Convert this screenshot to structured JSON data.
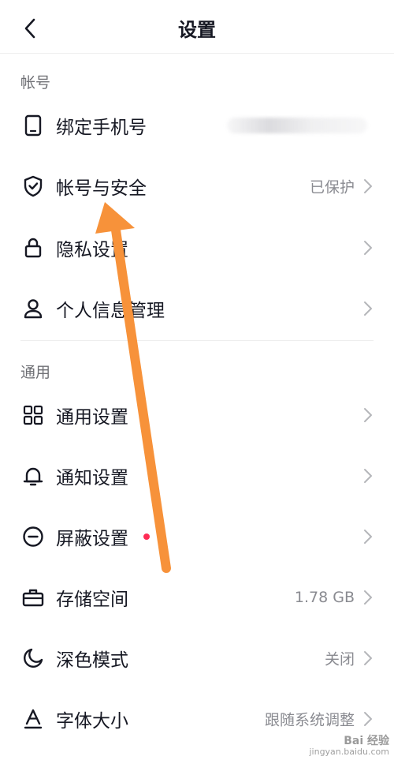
{
  "header": {
    "title": "设置",
    "back_icon": "chevron-left-icon"
  },
  "sections": {
    "account": {
      "title": "帐号",
      "items": [
        {
          "label": "绑定手机号",
          "value": "",
          "icon": "phone-icon"
        },
        {
          "label": "帐号与安全",
          "value": "已保护",
          "icon": "shield-check-icon"
        },
        {
          "label": "隐私设置",
          "value": "",
          "icon": "lock-icon"
        },
        {
          "label": "个人信息管理",
          "value": "",
          "icon": "user-icon"
        }
      ]
    },
    "general": {
      "title": "通用",
      "items": [
        {
          "label": "通用设置",
          "value": "",
          "icon": "grid-icon"
        },
        {
          "label": "通知设置",
          "value": "",
          "icon": "bell-icon"
        },
        {
          "label": "屏蔽设置",
          "value": "",
          "icon": "minus-circle-icon",
          "badge_color": "#fe2c55"
        },
        {
          "label": "存储空间",
          "value": "1.78 GB",
          "icon": "briefcase-icon"
        },
        {
          "label": "深色模式",
          "value": "关闭",
          "icon": "moon-icon"
        },
        {
          "label": "字体大小",
          "value": "跟随系统调整",
          "icon": "font-icon"
        }
      ]
    }
  },
  "annotation": {
    "color": "#f7923a"
  },
  "watermark": {
    "logo": "Bai 经验",
    "url": "jingyan.baidu.com"
  }
}
